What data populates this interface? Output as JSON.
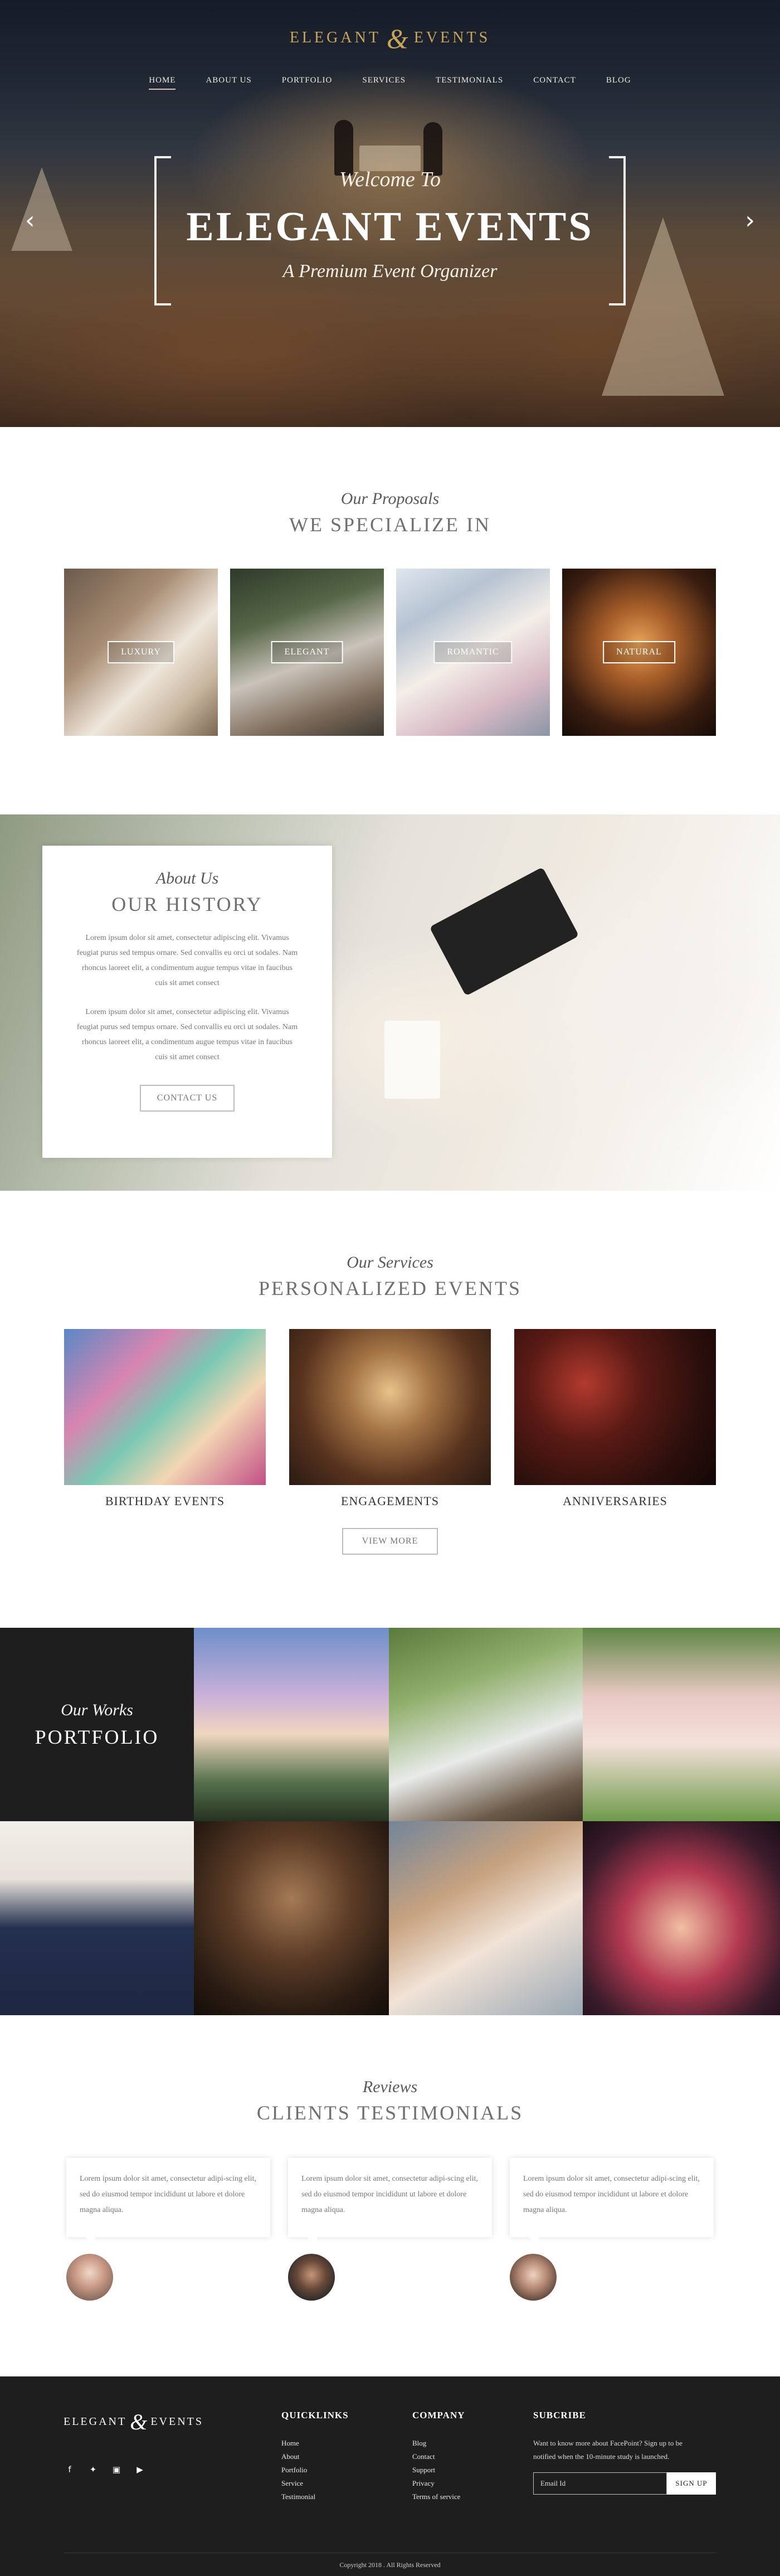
{
  "brand": {
    "name_left": "ELEGANT",
    "name_right": "EVENTS",
    "monogram": "&"
  },
  "nav": [
    "HOME",
    "ABOUT US",
    "PORTFOLIO",
    "SERVICES",
    "TESTIMONIALS",
    "CONTACT",
    "BLOG"
  ],
  "hero": {
    "welcome": "Welcome To",
    "title": "ELEGANT EVENTS",
    "subtitle": "A Premium Event Organizer",
    "prev_icon": "chevron-left-icon",
    "next_icon": "chevron-right-icon"
  },
  "specialize": {
    "kicker": "Our Proposals",
    "title": "WE SPECIALIZE IN",
    "items": [
      "LUXURY",
      "ELEGANT",
      "ROMANTIC",
      "NATURAL"
    ]
  },
  "history": {
    "kicker": "About Us",
    "title": "OUR HISTORY",
    "p1": "Lorem ipsum dolor sit amet, consectetur adipiscing elit. Vivamus feugiat purus sed tempus ornare. Sed convallis eu orci ut sodales. Nam rhoncus laoreet elit, a condimentum augue tempus vitae in faucibus cuis sit amet consect",
    "p2": "Lorem ipsum dolor sit amet, consectetur adipiscing elit. Vivamus feugiat purus sed tempus ornare. Sed convallis eu orci ut sodales. Nam rhoncus laoreet elit, a condimentum augue tempus vitae in faucibus cuis sit amet consect",
    "button": "CONTACT US"
  },
  "services": {
    "kicker": "Our Services",
    "title": "PERSONALIZED EVENTS",
    "items": [
      "BIRTHDAY EVENTS",
      "ENGAGEMENTS",
      "ANNIVERSARIES"
    ],
    "button": "VIEW MORE"
  },
  "portfolio": {
    "kicker": "Our Works",
    "title": "PORTFOLIO"
  },
  "testimonials": {
    "kicker": "Reviews",
    "title": "CLIENTS TESTIMONIALS",
    "items": [
      "Lorem ipsum dolor sit amet, consectetur adipi-scing elit, sed do eiusmod tempor incididunt ut labore et dolore magna aliqua.",
      "Lorem ipsum dolor sit amet, consectetur adipi-scing elit, sed do eiusmod tempor incididunt ut labore et dolore magna aliqua.",
      "Lorem ipsum dolor sit amet, consectetur adipi-scing elit, sed do eiusmod tempor incididunt ut labore et dolore magna aliqua."
    ]
  },
  "footer": {
    "quicklinks_title": "QUICKLINKS",
    "quicklinks": [
      "Home",
      "About",
      "Portfolio",
      "Service",
      "Testimonial"
    ],
    "company_title": "COMPANY",
    "company": [
      "Blog",
      "Contact",
      "Support",
      "Privacy",
      "Terms of service"
    ],
    "subscribe_title": "SUBCRIBE",
    "subscribe_text": "Want to know more about FacePoint? Sign up to be notified when the 10-minute study is launched.",
    "email_placeholder": "Email Id",
    "signup": "SIGN UP",
    "socials": [
      "facebook-icon",
      "twitter-icon",
      "instagram-icon",
      "youtube-icon"
    ],
    "copyright": "Copyright 2018 . All Rights Reserved"
  }
}
